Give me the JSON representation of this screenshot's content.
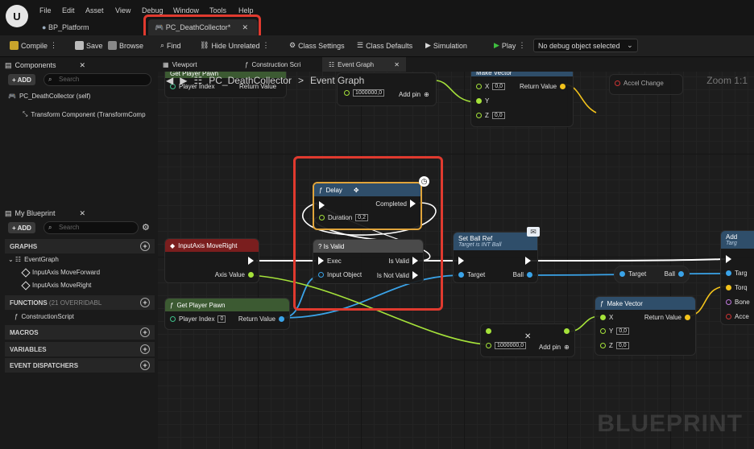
{
  "menu": [
    "File",
    "Edit",
    "Asset",
    "View",
    "Debug",
    "Window",
    "Tools",
    "Help"
  ],
  "doc_tabs": [
    {
      "label": "BP_Platform"
    },
    {
      "label": "PC_DeathCollector*"
    }
  ],
  "toolbar": {
    "compile": "Compile",
    "save": "Save",
    "browse": "Browse",
    "find": "Find",
    "hide_unrelated": "Hide Unrelated",
    "class_settings": "Class Settings",
    "class_defaults": "Class Defaults",
    "simulation": "Simulation",
    "play": "Play",
    "debug_object": "No debug object selected"
  },
  "components": {
    "tab": "Components",
    "add": "+ ADD",
    "search_placeholder": "Search",
    "items": [
      "PC_DeathCollector (self)",
      "Transform Component (TransformComp"
    ]
  },
  "my_blueprint": {
    "tab": "My Blueprint",
    "add": "+ ADD",
    "search_placeholder": "Search",
    "graphs": "GRAPHS",
    "event_graph": "EventGraph",
    "graph_items": [
      "InputAxis MoveForward",
      "InputAxis MoveRight"
    ],
    "functions": "FUNCTIONS",
    "functions_note": "(21 OVERRIDABL",
    "construction": "ConstructionScript",
    "macros": "MACROS",
    "variables": "VARIABLES",
    "dispatchers": "EVENT DISPATCHERS"
  },
  "graph_tabs": [
    "Viewport",
    "Construction Scri",
    "Event Graph"
  ],
  "breadcrumb": {
    "root": "PC_DeathCollector",
    "sep": ">",
    "current": "Event Graph"
  },
  "zoom": "Zoom 1:1",
  "watermark": "BLUEPRINT",
  "nodes": {
    "delay": {
      "title": "Delay",
      "completed": "Completed",
      "duration_label": "Duration",
      "duration": "0,2"
    },
    "isvalid": {
      "title": "? Is Valid",
      "exec": "Exec",
      "input": "Input Object",
      "is_valid": "Is Valid",
      "not_valid": "Is Not Valid"
    },
    "input_axis": {
      "title": "InputAxis MoveRight",
      "axis_value": "Axis Value"
    },
    "get_pawn": {
      "title": "Get Player Pawn",
      "player_index": "Player Index",
      "index_val": "0",
      "return": "Return Value"
    },
    "get_pawn_top": {
      "title": "Get Player Pawn",
      "player_index": "Player Index",
      "return": "Return Value"
    },
    "set_ball": {
      "title": "Set Ball Ref",
      "subtitle": "Target is INT Ball",
      "target": "Target",
      "ball": "Ball"
    },
    "target_ball": {
      "target": "Target",
      "ball": "Ball"
    },
    "make_vector": {
      "title": "Make Vector",
      "x": "X",
      "y": "Y",
      "z": "Z",
      "y_val": "0,0",
      "z_val": "0,0",
      "return": "Return Value"
    },
    "make_vector_top": {
      "title": "Make Vector",
      "x": "X",
      "y": "Y",
      "z": "Z",
      "x_val": "0,0",
      "z_val": "0,0",
      "return": "Return Value"
    },
    "multiply": {
      "value": "1000000,0",
      "add_pin": "Add pin"
    },
    "multiply_top": {
      "value": "1000000,0",
      "add_pin": "Add pin"
    },
    "add_torque": {
      "title": "Add",
      "sub": "Targ",
      "pins": [
        "Targ",
        "Torq",
        "Bone",
        "Acce"
      ]
    },
    "accel_change": "Accel Change"
  },
  "colors": {
    "highlight": "#e03a2f",
    "exec": "#ffffff",
    "object": "#3aa3e8",
    "float": "#a5e23a",
    "vector": "#f2c21b"
  }
}
